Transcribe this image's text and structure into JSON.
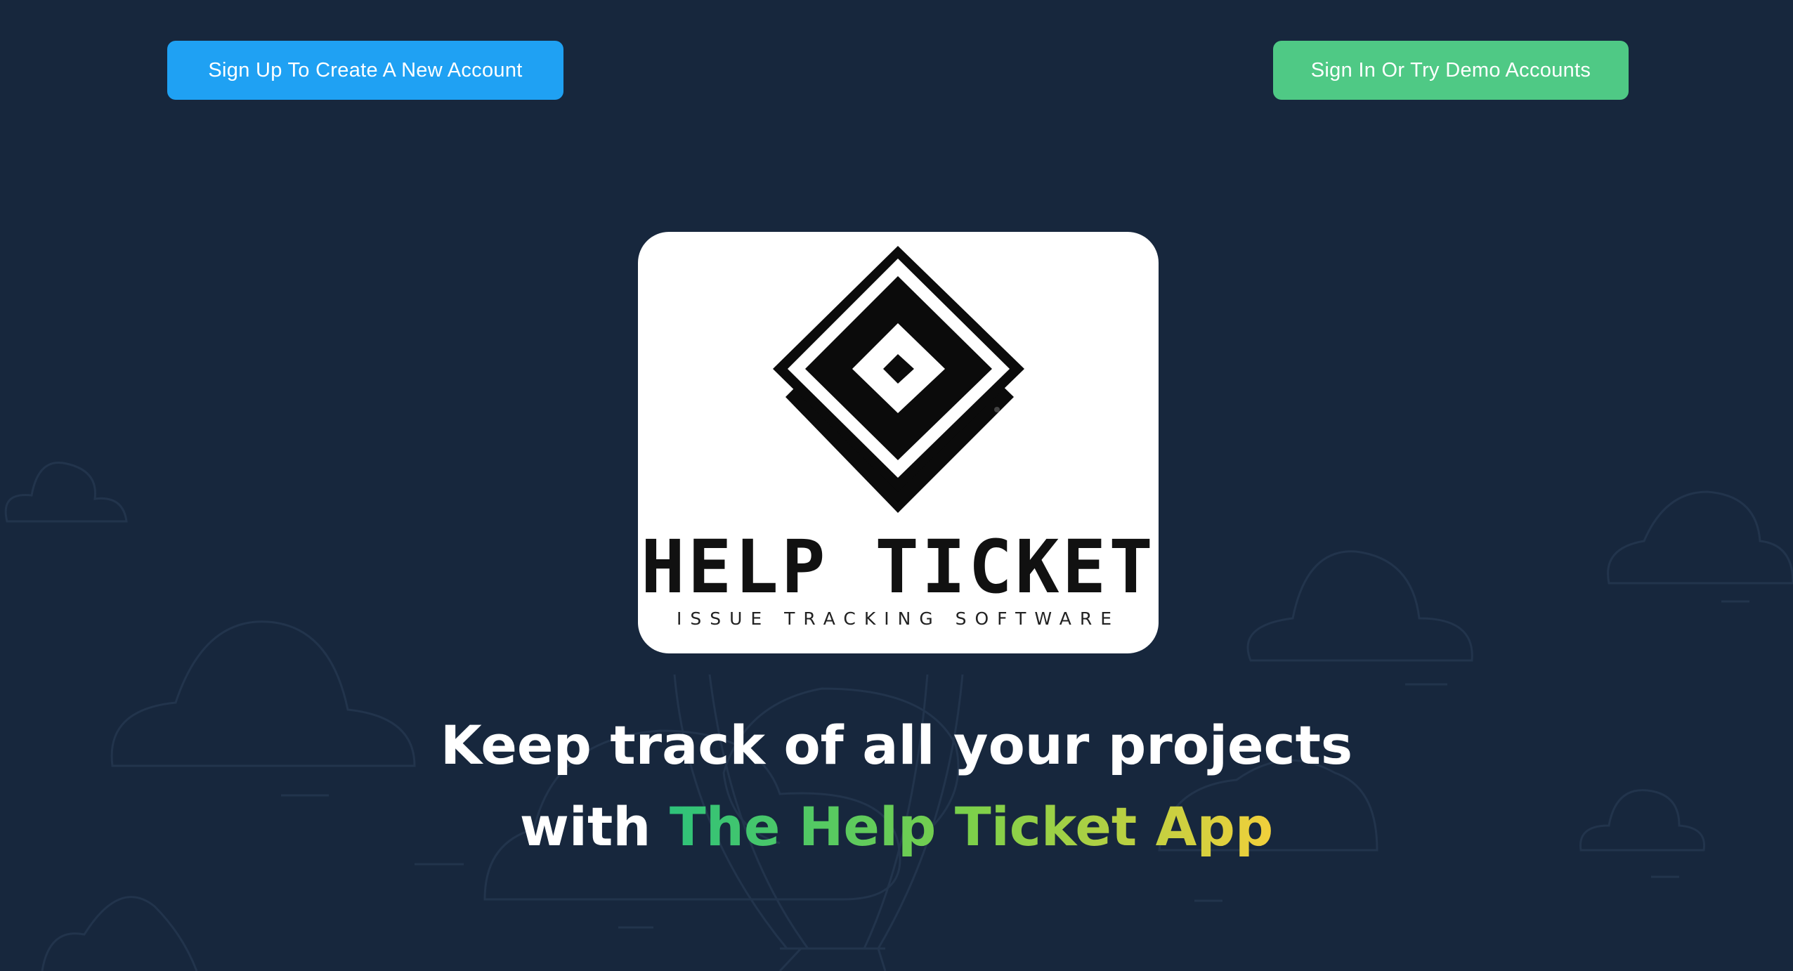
{
  "header": {
    "signup_label": "Sign Up To Create A New Account",
    "signin_label": "Sign In Or Try Demo Accounts"
  },
  "logo": {
    "wordmark": "HELP TICKET",
    "tagline": "ISSUE TRACKING SOFTWARE"
  },
  "hero": {
    "line1": "Keep track of all your projects",
    "line2_prefix": "with",
    "line2_highlight": "The Help Ticket App"
  },
  "colors": {
    "background": "#17273d",
    "signup_button": "#1fa1f3",
    "signin_button": "#4fc985",
    "highlight_start": "#2ec27a",
    "highlight_end": "#f2d03b"
  }
}
